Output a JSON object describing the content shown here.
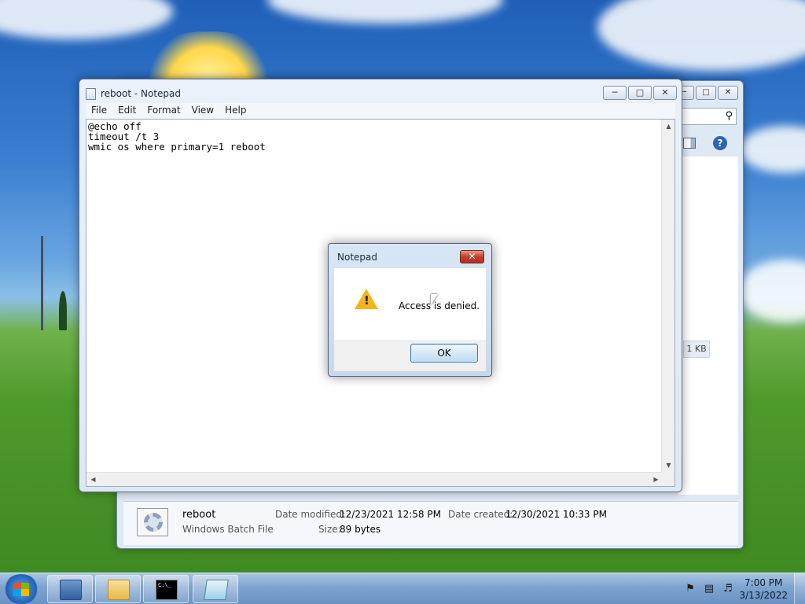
{
  "explorer": {
    "size_value": "1 KB",
    "details": {
      "file_name": "reboot",
      "file_type": "Windows Batch File",
      "date_modified_label": "Date modified:",
      "date_modified_value": "12/23/2021 12:58 PM",
      "date_created_label": "Date created:",
      "date_created_value": "12/30/2021 10:33 PM",
      "size_label": "Size:",
      "size_value": "89 bytes"
    }
  },
  "notepad": {
    "title": "reboot - Notepad",
    "menu": [
      "File",
      "Edit",
      "Format",
      "View",
      "Help"
    ],
    "content": "@echo off\ntimeout /t 3\nwmic os where primary=1 reboot"
  },
  "dialog": {
    "title": "Notepad",
    "message": "Access is denied.",
    "ok_label": "OK",
    "icon": "warning-icon"
  },
  "taskbar": {
    "apps": [
      "server-manager-icon",
      "file-explorer-icon",
      "command-prompt-icon",
      "notepad-icon"
    ],
    "cmd_icon_text": "C:\\_",
    "clock_time": "7:00 PM",
    "clock_date": "3/13/2022"
  },
  "colors": {
    "accent": "#3c7fb1",
    "close_red": "#c2402b",
    "warning": "#f2b51b"
  }
}
